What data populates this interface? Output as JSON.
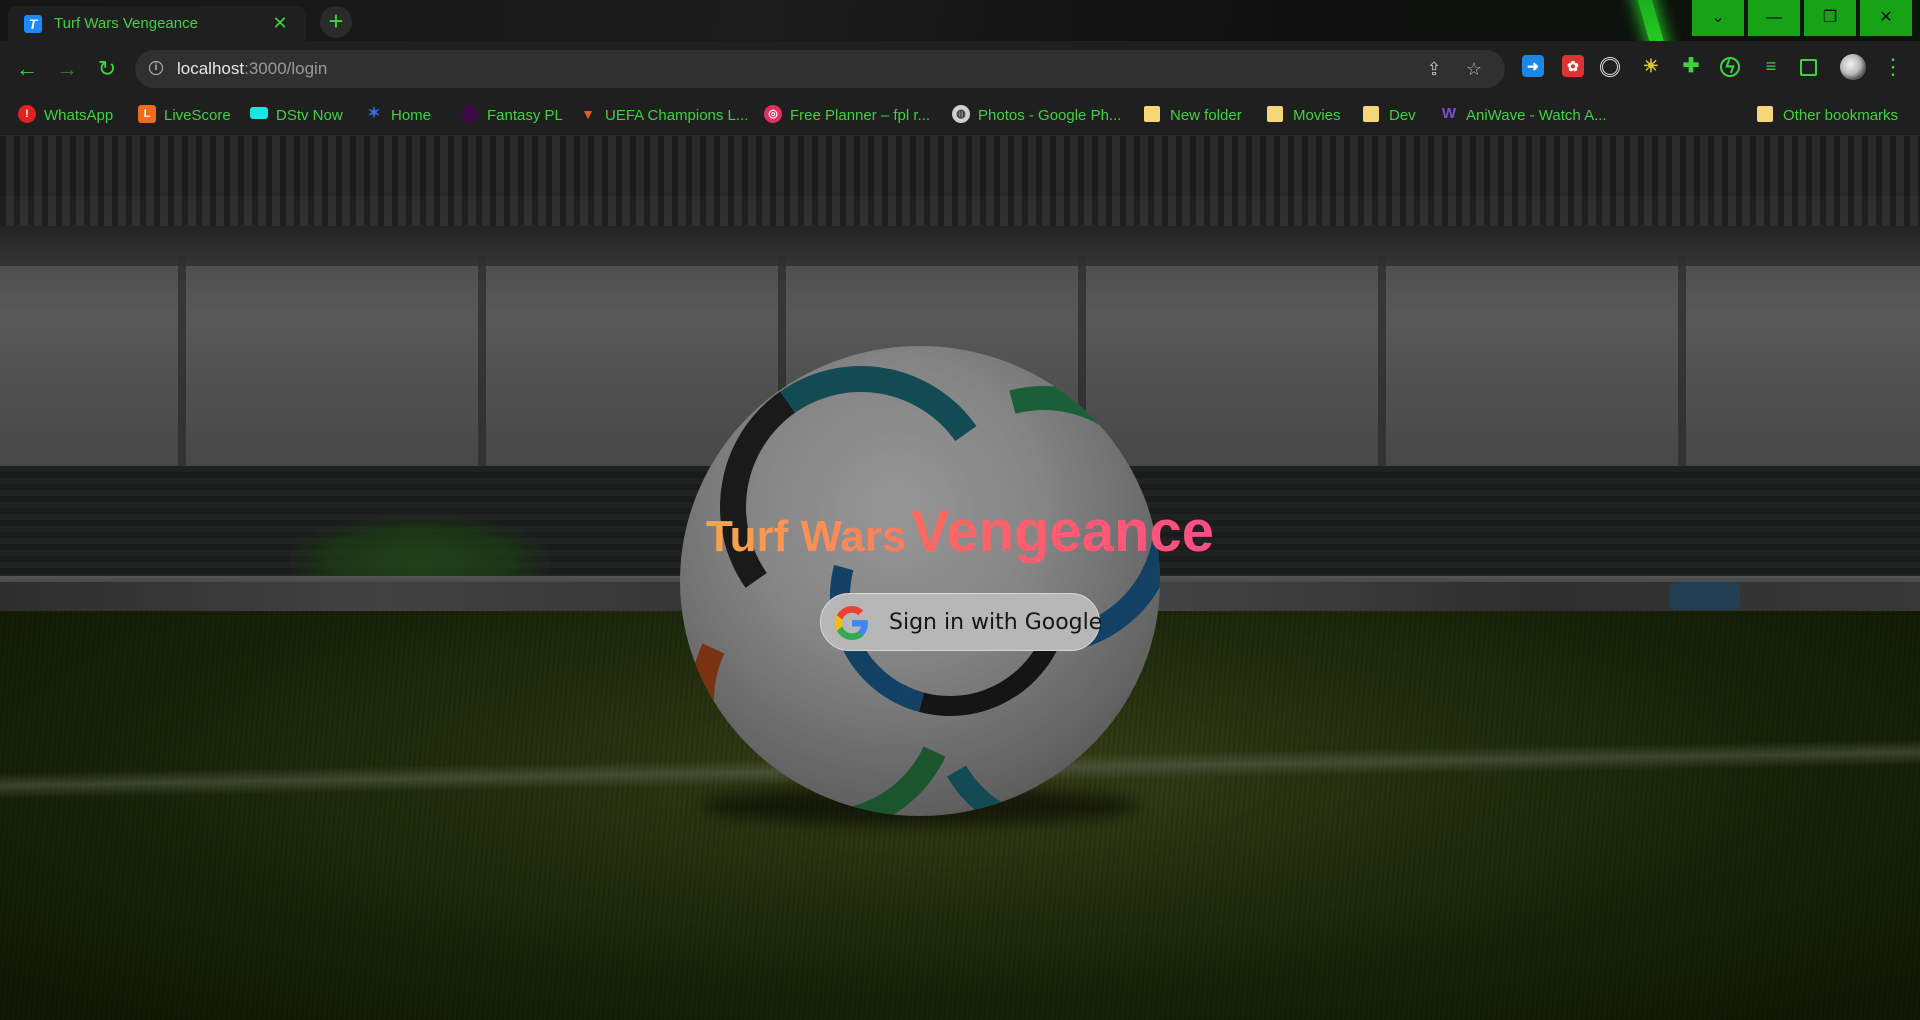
{
  "browser": {
    "tab": {
      "title": "Turf Wars Vengeance",
      "favicon": "T"
    },
    "new_tab_glyph": "+",
    "window_controls": [
      "⌄",
      "—",
      "❐",
      "✕"
    ],
    "address": {
      "host": "localhost",
      "path": ":3000/login"
    },
    "extensions": [
      "extension-blue-icon",
      "extension-red-icon",
      "extension-target-icon",
      "extension-sun-icon",
      "puzzle-icon",
      "extension-bolt-icon",
      "media-control-icon",
      "side-panel-icon"
    ],
    "bookmarks": [
      {
        "label": "WhatsApp",
        "icon": "whatsapp-icon",
        "color": "#e0211e"
      },
      {
        "label": "LiveScore",
        "icon": "livescore-icon",
        "color": "#f26b1d"
      },
      {
        "label": "DStv Now",
        "icon": "dstv-icon",
        "color": "#17e6e0"
      },
      {
        "label": "Home",
        "icon": "home-star-icon",
        "color": "#2f6fe0"
      },
      {
        "label": "Fantasy PL",
        "icon": "fantasy-pl-icon",
        "color": "#3a0b44"
      },
      {
        "label": "UEFA Champions L...",
        "icon": "uefa-icon",
        "color": "#e85b26"
      },
      {
        "label": "Free Planner – fpl r...",
        "icon": "planner-icon",
        "color": "#e03060"
      },
      {
        "label": "Photos - Google Ph...",
        "icon": "globe-icon",
        "color": "#cfcfcf"
      },
      {
        "label": "New folder",
        "icon": "folder-icon",
        "color": "#f5d77a"
      },
      {
        "label": "Movies",
        "icon": "folder-icon",
        "color": "#f5d77a"
      },
      {
        "label": "Dev",
        "icon": "folder-icon",
        "color": "#f5d77a"
      },
      {
        "label": "AniWave - Watch A...",
        "icon": "aniwave-icon",
        "color": "#7a4fd6"
      }
    ],
    "other_bookmarks": "Other bookmarks",
    "accent_color": "#3fd33f"
  },
  "page": {
    "title_part1": "Turf Wars",
    "title_part2": "Vengeance",
    "signin_label": "Sign in with Google"
  }
}
